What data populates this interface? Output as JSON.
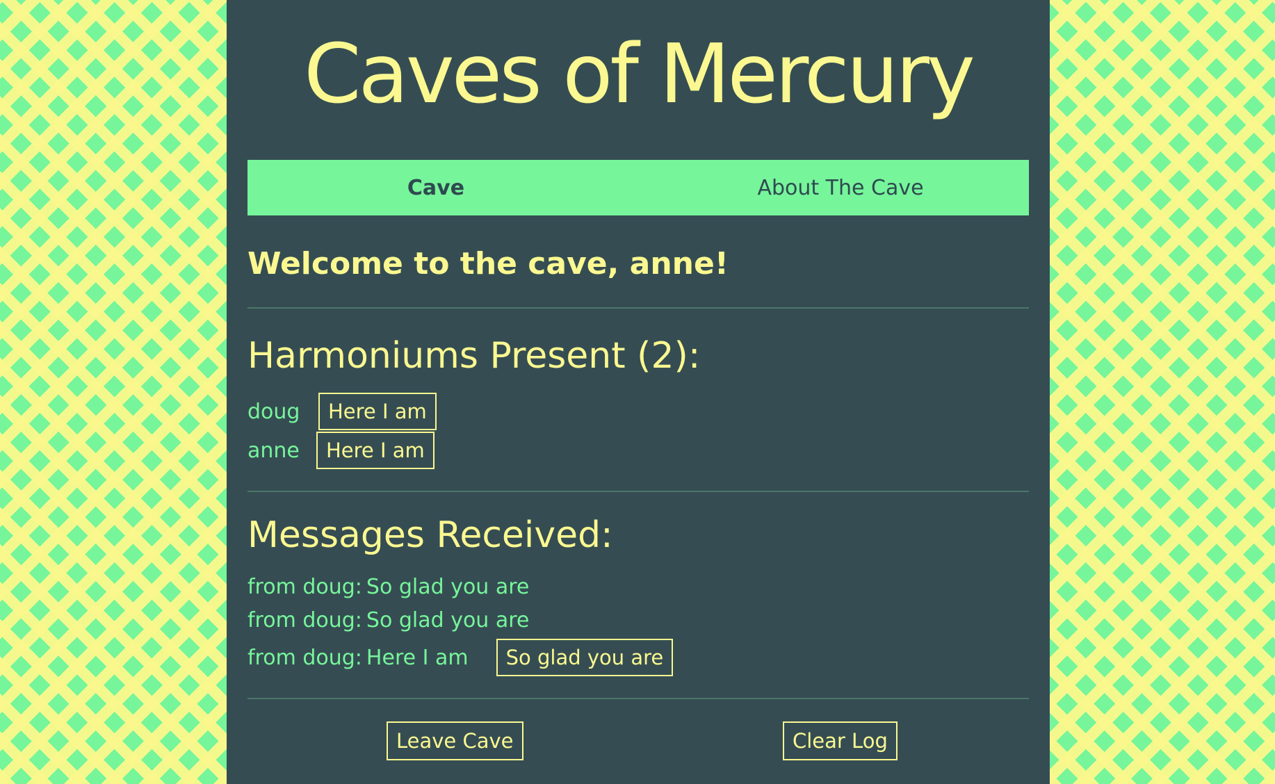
{
  "site": {
    "title": "Caves of Mercury"
  },
  "nav": {
    "items": [
      {
        "label": "Cave",
        "active": true
      },
      {
        "label": "About The Cave",
        "active": false
      }
    ]
  },
  "welcome": "Welcome to the cave, anne!",
  "harmoniums": {
    "heading": "Harmoniums Present (2):",
    "list": [
      {
        "name": "doug",
        "button": "Here I am"
      },
      {
        "name": "anne",
        "button": "Here I am"
      }
    ]
  },
  "messages": {
    "heading": "Messages Received:",
    "list": [
      {
        "from": "from doug:",
        "text": "So glad you are"
      },
      {
        "from": "from doug:",
        "text": "So glad you are"
      },
      {
        "from": "from doug:",
        "text": "Here I am",
        "reply_button": "So glad you are"
      }
    ]
  },
  "footer": {
    "leave_label": "Leave Cave",
    "clear_label": "Clear Log"
  },
  "colors": {
    "panel": "#354d52",
    "accent_green": "#76f59b",
    "accent_yellow": "#fbf891"
  }
}
